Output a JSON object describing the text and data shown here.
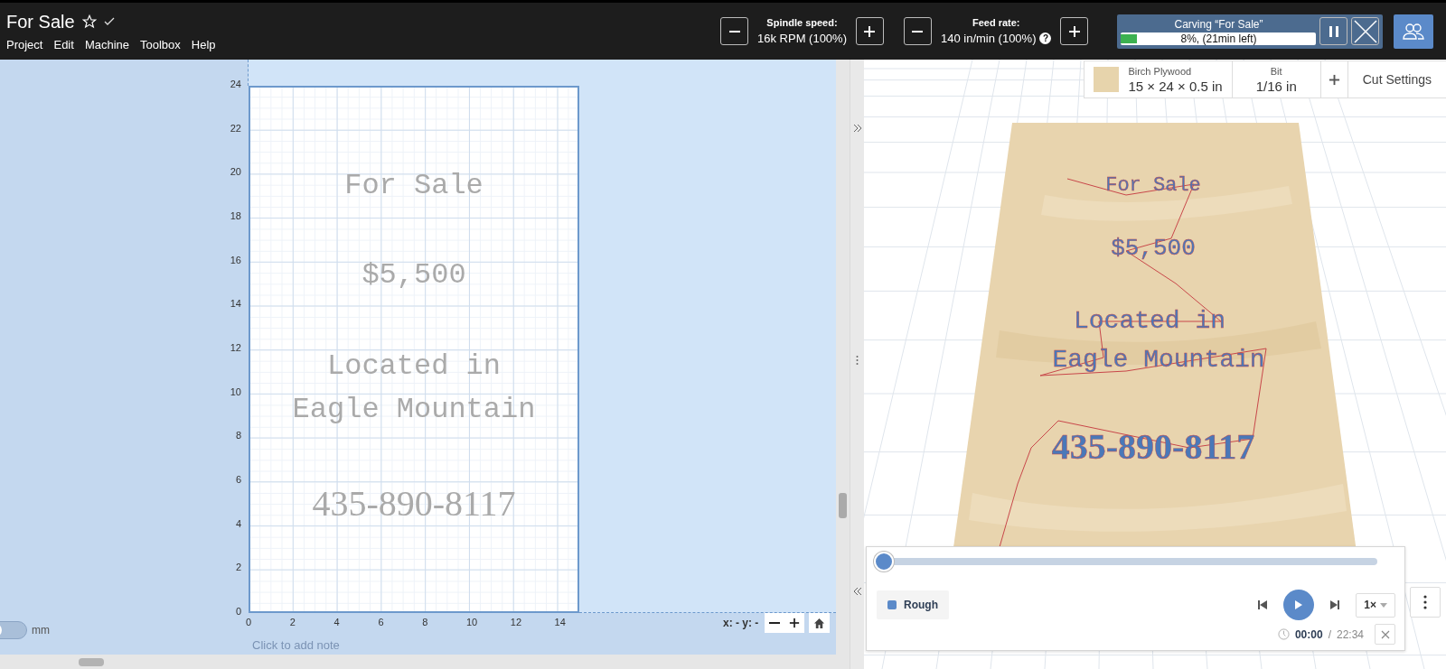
{
  "project": {
    "title": "For Sale",
    "starred": false,
    "saved": true
  },
  "menu": [
    "Project",
    "Edit",
    "Machine",
    "Toolbox",
    "Help"
  ],
  "spindle": {
    "label": "Spindle speed:",
    "value": "16k RPM (100%)"
  },
  "feed": {
    "label": "Feed rate:",
    "value": "140 in/min (100%)",
    "help": "?"
  },
  "carving": {
    "title": "Carving “For Sale”",
    "progress": "8%, (21min left)",
    "level": 0.08
  },
  "design": {
    "y_ticks": [
      "24",
      "22",
      "20",
      "18",
      "16",
      "14",
      "12",
      "10",
      "8",
      "6",
      "4",
      "2",
      "0"
    ],
    "x_ticks": [
      "0",
      "2",
      "4",
      "6",
      "8",
      "10",
      "12",
      "14"
    ],
    "texts": [
      {
        "text": "For Sale",
        "kind": "mono"
      },
      {
        "text": "$5,500",
        "kind": "mono"
      },
      {
        "text": "Located in",
        "kind": "mono"
      },
      {
        "text": "Eagle Mountain",
        "kind": "mono"
      },
      {
        "text": "435-890-8117",
        "kind": "serif"
      }
    ],
    "units": "mm",
    "units_on": false,
    "note_hint": "Click to add note",
    "coords": "x: - y: -"
  },
  "material": {
    "name": "Birch Plywood",
    "size": "15 × 24 × 0.5 in"
  },
  "bit": {
    "label": "Bit",
    "value": "1/16 in"
  },
  "cut_settings": "Cut Settings",
  "preview": {
    "texts": [
      {
        "text": "For Sale",
        "kind": "mono"
      },
      {
        "text": "$5,500",
        "kind": "mono"
      },
      {
        "text": "Located in",
        "kind": "mono"
      },
      {
        "text": "Eagle Mountain",
        "kind": "mono"
      },
      {
        "text": "435-890-8117",
        "kind": "serif"
      }
    ]
  },
  "player": {
    "level": 0,
    "layer": {
      "name": "Rough",
      "color": "#5b8ac9"
    },
    "speed": "1×",
    "elapsed": "00:00",
    "separator": "/",
    "total": "22:34"
  }
}
